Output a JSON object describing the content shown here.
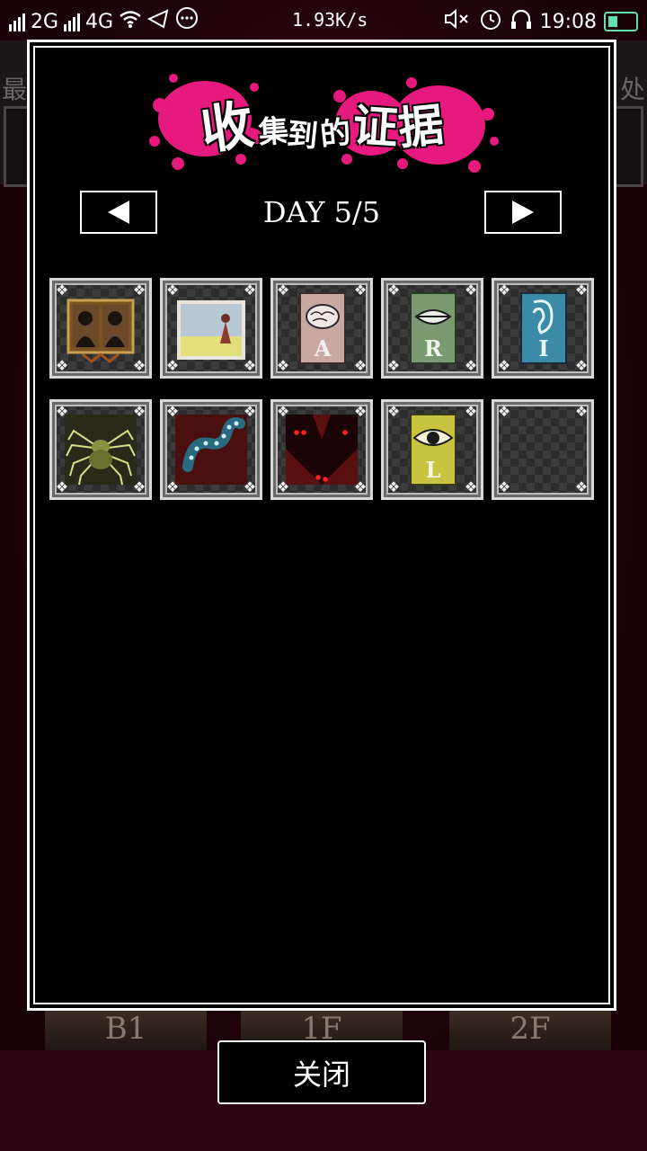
{
  "status_bar": {
    "signal1": "2G",
    "signal2": "4G",
    "speed": "1.93K/s",
    "time": "19:08"
  },
  "background": {
    "top_left_char": "最",
    "top_right_char": "处",
    "floors": [
      "B1",
      "1F",
      "2F"
    ]
  },
  "dialog": {
    "title_chars": [
      "收",
      "集",
      "到",
      "的",
      "证",
      "据"
    ],
    "title_splash_color": "#e6197f",
    "day_label": "DAY 5/5",
    "prev_icon": "left-triangle-icon",
    "next_icon": "right-triangle-icon",
    "evidence": [
      {
        "name": "twin-silhouettes-portrait",
        "letter": ""
      },
      {
        "name": "girl-in-field-photo",
        "letter": ""
      },
      {
        "name": "brain-card",
        "letter": "A"
      },
      {
        "name": "lips-card",
        "letter": "R"
      },
      {
        "name": "ear-card",
        "letter": "I"
      },
      {
        "name": "spider",
        "letter": ""
      },
      {
        "name": "spotted-tentacle",
        "letter": ""
      },
      {
        "name": "red-eyed-shadow",
        "letter": ""
      },
      {
        "name": "eye-card",
        "letter": "L"
      },
      {
        "name": "empty-slot",
        "letter": ""
      }
    ]
  },
  "close_button_label": "关闭"
}
